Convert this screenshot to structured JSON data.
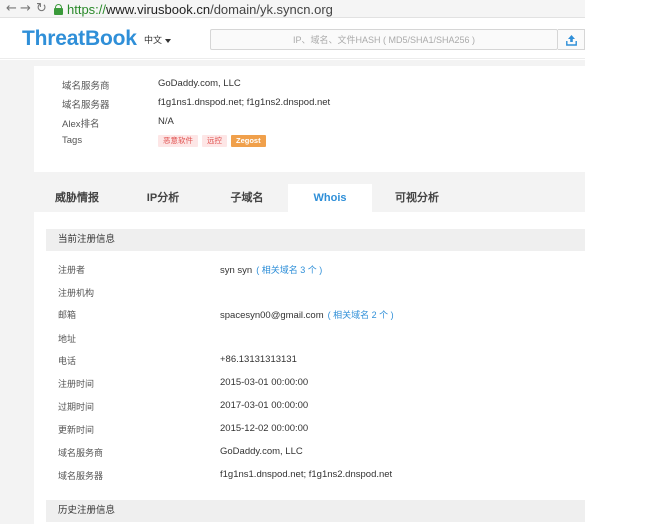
{
  "browser": {
    "back_glyph": "←",
    "forward_glyph": "→",
    "reload_glyph": "↻",
    "url_scheme": "https://",
    "url_host": "www.virusbook.cn",
    "url_path": "/domain/yk.syncn.org"
  },
  "header": {
    "logo": "ThreatBook",
    "language": "中文",
    "search_placeholder": "IP、域名、文件HASH ( MD5/SHA1/SHA256 )",
    "upload_icon": "upload-icon"
  },
  "domain_info": {
    "rows": [
      {
        "label": "域名服务商",
        "value": "GoDaddy.com, LLC"
      },
      {
        "label": "域名服务器",
        "value": "f1g1ns1.dnspod.net; f1g1ns2.dnspod.net"
      },
      {
        "label": "Alex排名",
        "value": "N/A"
      }
    ],
    "tags_label": "Tags",
    "tags": [
      "恶意软件",
      "远控",
      "Zegost"
    ]
  },
  "tabs": [
    "威胁情报",
    "IP分析",
    "子域名",
    "Whois",
    "可视分析"
  ],
  "active_tab": "Whois",
  "whois": {
    "current_title": "当前注册信息",
    "rows": [
      {
        "label": "注册者",
        "value": "syn syn",
        "related": "( 相关域名 3 个 )"
      },
      {
        "label": "注册机构",
        "value": "",
        "related": ""
      },
      {
        "label": "邮箱",
        "value": "spacesyn00@gmail.com",
        "related": "( 相关域名 2 个 )"
      },
      {
        "label": "地址",
        "value": "",
        "related": ""
      },
      {
        "label": "电话",
        "value": "+86.13131313131",
        "related": ""
      },
      {
        "label": "注册时间",
        "value": "2015-03-01 00:00:00",
        "related": ""
      },
      {
        "label": "过期时间",
        "value": "2017-03-01 00:00:00",
        "related": ""
      },
      {
        "label": "更新时间",
        "value": "2015-12-02 00:00:00",
        "related": ""
      },
      {
        "label": "域名服务商",
        "value": "GoDaddy.com, LLC",
        "related": ""
      },
      {
        "label": "域名服务器",
        "value": "f1g1ns1.dnspod.net; f1g1ns2.dnspod.net",
        "related": ""
      }
    ],
    "history_title": "历史注册信息"
  },
  "colors": {
    "accent": "#2f8fd8",
    "tag_red": "#e0504e",
    "tag_orange": "#f0a04b"
  }
}
